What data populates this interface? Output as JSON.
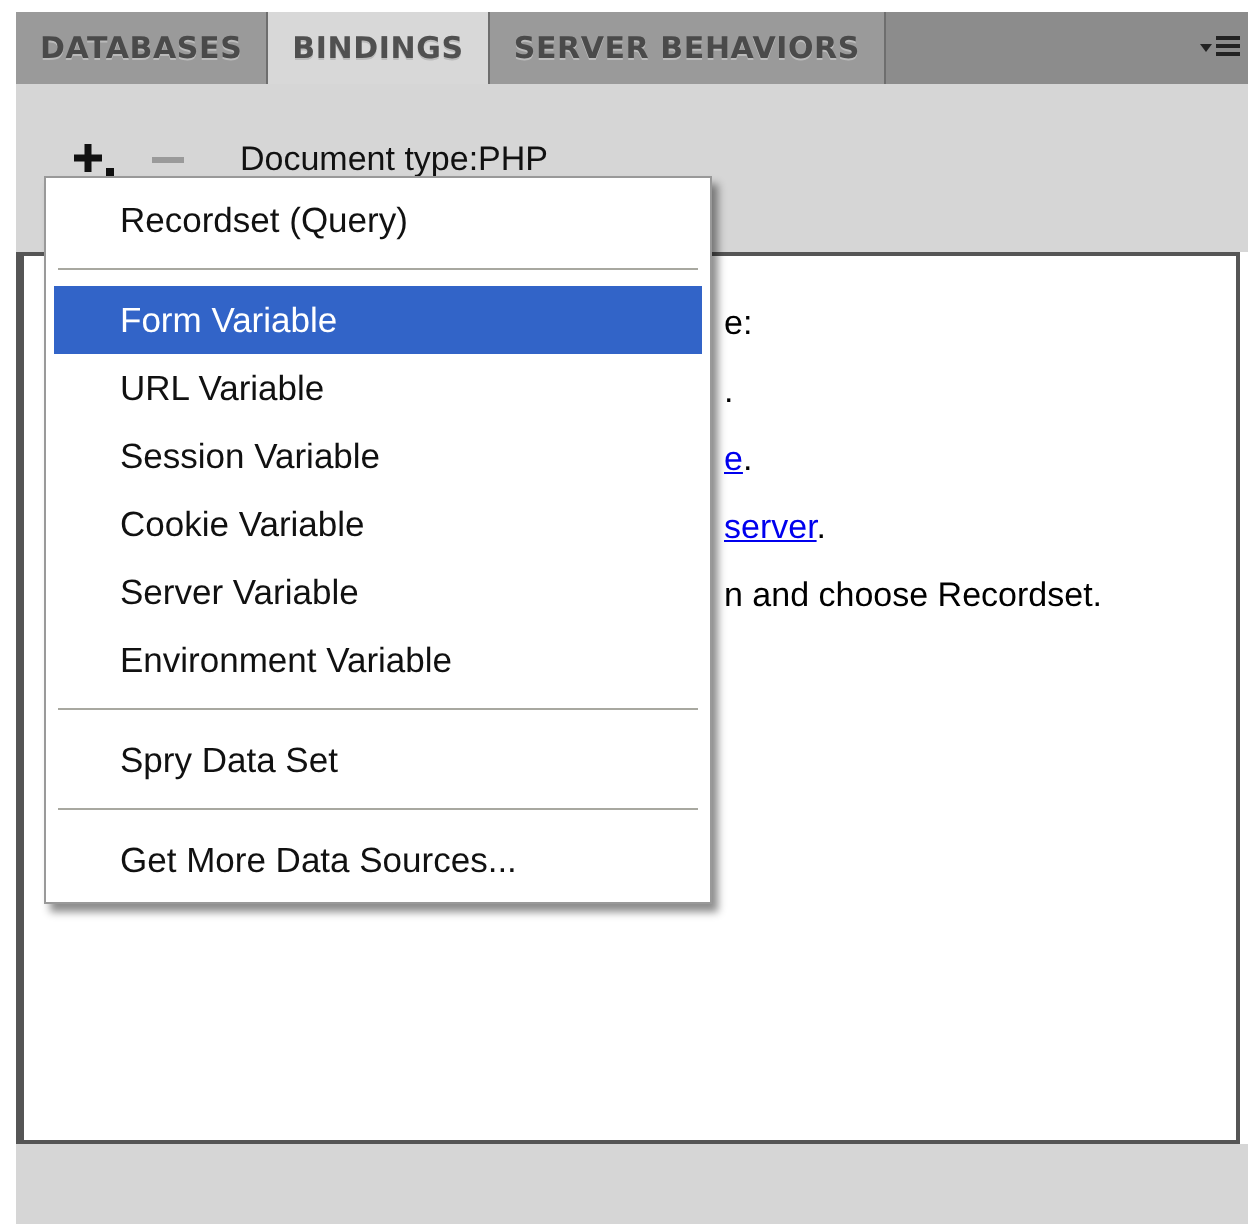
{
  "tabs": [
    {
      "label": "DATABASES",
      "selected": false
    },
    {
      "label": "BINDINGS",
      "selected": true
    },
    {
      "label": "SERVER BEHAVIORS",
      "selected": false
    }
  ],
  "toolbar": {
    "document_type": "Document type:PHP"
  },
  "content_lines": [
    {
      "parts": [
        {
          "text": "e:",
          "link": false
        }
      ]
    },
    {
      "parts": [
        {
          "text": ".",
          "link": false
        }
      ]
    },
    {
      "parts": [
        {
          "text": "e",
          "link": true
        },
        {
          "text": ".",
          "link": false
        }
      ]
    },
    {
      "parts": [
        {
          "text": "server",
          "link": true
        },
        {
          "text": ".",
          "link": false
        }
      ]
    },
    {
      "parts": [
        {
          "text": "n and choose Recordset.",
          "link": false
        }
      ]
    }
  ],
  "menu": [
    {
      "kind": "item",
      "label": "Recordset (Query)",
      "selected": false
    },
    {
      "kind": "separator"
    },
    {
      "kind": "item",
      "label": "Form Variable",
      "selected": true
    },
    {
      "kind": "item",
      "label": "URL Variable",
      "selected": false
    },
    {
      "kind": "item",
      "label": "Session Variable",
      "selected": false
    },
    {
      "kind": "item",
      "label": "Cookie Variable",
      "selected": false
    },
    {
      "kind": "item",
      "label": "Server Variable",
      "selected": false
    },
    {
      "kind": "item",
      "label": "Environment Variable",
      "selected": false
    },
    {
      "kind": "separator"
    },
    {
      "kind": "item",
      "label": "Spry Data Set",
      "selected": false
    },
    {
      "kind": "separator"
    },
    {
      "kind": "item",
      "label": "Get More Data Sources...",
      "selected": false
    }
  ]
}
